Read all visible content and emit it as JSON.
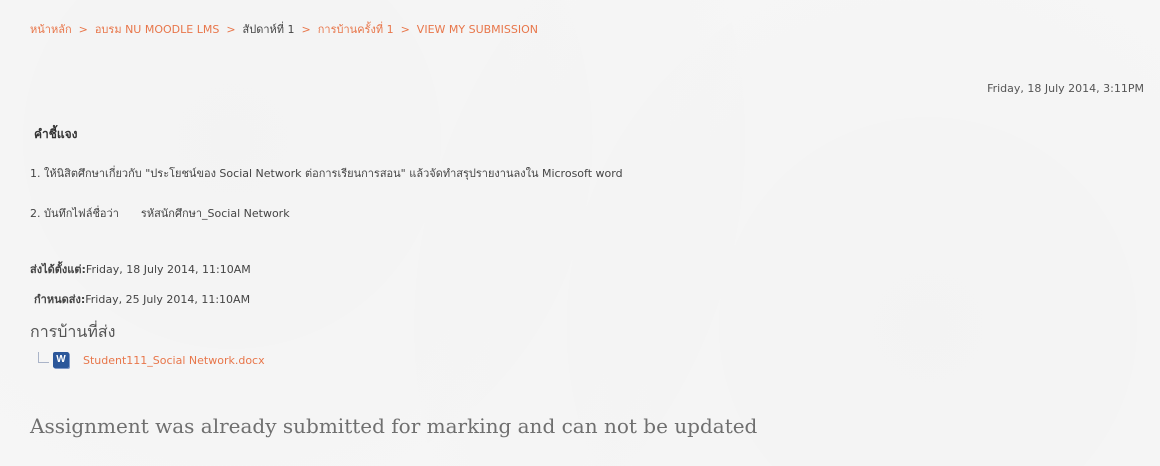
{
  "breadcrumb": {
    "items": [
      {
        "label": "หน้าหลัก",
        "link": true
      },
      {
        "label": "อบรม NU MOODLE LMS",
        "link": true
      },
      {
        "label": "สัปดาห์ที่ 1",
        "link": false
      },
      {
        "label": "การบ้านครั้งที่ 1",
        "link": true
      },
      {
        "label": "VIEW MY SUBMISSION",
        "link": true
      }
    ],
    "separator": ">"
  },
  "header": {
    "date": "Friday, 18 July 2014, 3:11PM"
  },
  "instructions": {
    "heading": "คำชี้แจง",
    "line1": "1. ให้นิสิตศึกษาเกี่ยวกับ \"ประโยชน์ของ Social Network ต่อการเรียนการสอน\"  แล้วจัดทำสรุปรายงานลงใน Microsoft word",
    "line2_prefix": "2. บันทึกไฟล์ชื่อว่า",
    "line2_value": "รหัสนักศึกษา_Social Network"
  },
  "meta": {
    "opened_label": "ส่งได้ตั้งแต่:",
    "opened_value": "Friday, 18 July 2014, 11:10AM",
    "due_label": "กำหนดส่ง:",
    "due_value": "Friday, 25 July 2014, 11:10AM"
  },
  "submission": {
    "title": "การบ้านที่ส่ง",
    "file_icon": "word-document-icon",
    "file_icon_letter": "W",
    "file_name": "Student111_Social Network.docx",
    "status_message": "Assignment was already submitted for marking and can not be updated"
  },
  "colors": {
    "link": "#e8764a",
    "background": "#f7f7f7",
    "word_icon": "#2b579a"
  }
}
